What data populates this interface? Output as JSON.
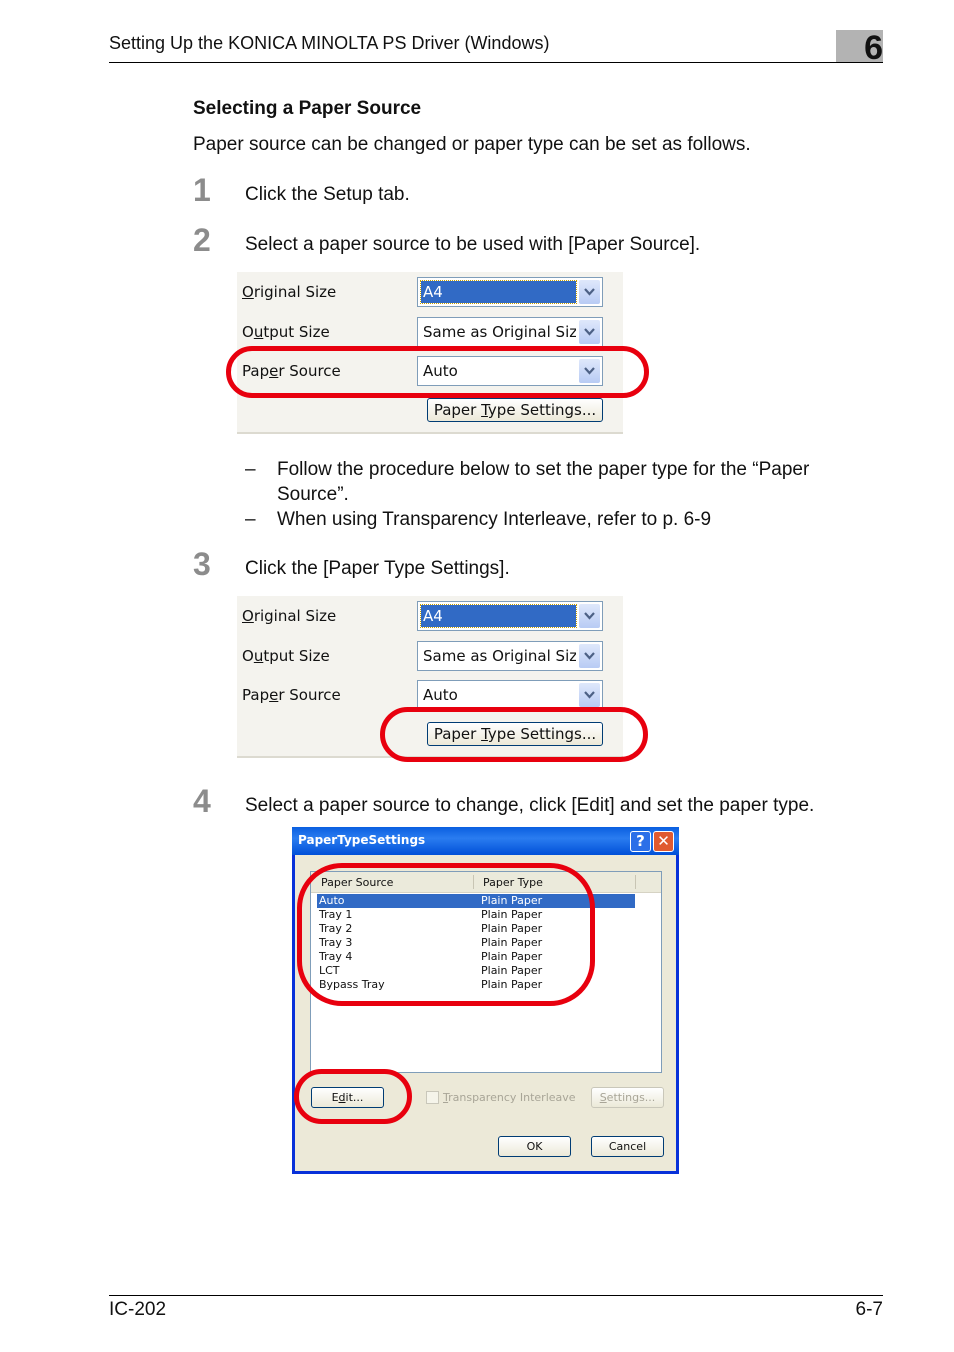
{
  "header": {
    "title": "Setting Up the KONICA MINOLTA PS Driver (Windows)",
    "chapter": "6"
  },
  "section": {
    "title": "Selecting a Paper Source",
    "intro": "Paper source can be changed or paper type can be set as follows."
  },
  "steps": [
    {
      "num": "1",
      "text": "Click the Setup tab."
    },
    {
      "num": "2",
      "text": "Select a paper source to be used with [Paper Source]."
    },
    {
      "num": "3",
      "text": "Click the [Paper Type Settings]."
    },
    {
      "num": "4",
      "text": "Select a paper source to change, click [Edit] and set the paper type."
    }
  ],
  "bullets": [
    {
      "dash": "–",
      "text": "Follow the procedure below to set the paper type for the “Paper Source”."
    },
    {
      "dash": "–",
      "text": "When using Transparency Interleave, refer to p. 6-9"
    }
  ],
  "driver_panel": {
    "original_size_label": "Original Size",
    "original_size_value": "A4",
    "output_size_label": "Output Size",
    "output_size_value": "Same as Original Size",
    "paper_source_label": "Paper Source",
    "paper_source_value": "Auto",
    "paper_type_button": "Paper Type Settings...",
    "dropdown_icon": "chevron-down-icon"
  },
  "dialog": {
    "title": "PaperTypeSettings",
    "help_glyph": "?",
    "close_glyph": "✕",
    "columns": [
      "Paper Source",
      "Paper Type"
    ],
    "rows": [
      {
        "source": "Auto",
        "type": "Plain Paper",
        "selected": true
      },
      {
        "source": "Tray 1",
        "type": "Plain Paper"
      },
      {
        "source": "Tray 2",
        "type": "Plain Paper"
      },
      {
        "source": "Tray 3",
        "type": "Plain Paper"
      },
      {
        "source": "Tray 4",
        "type": "Plain Paper"
      },
      {
        "source": "LCT",
        "type": "Plain Paper"
      },
      {
        "source": "Bypass Tray",
        "type": "Plain Paper"
      }
    ],
    "edit_button": "Edit...",
    "transparency_label": "Transparency Interleave",
    "settings_button": "Settings...",
    "ok_button": "OK",
    "cancel_button": "Cancel"
  },
  "footer": {
    "left": "IC-202",
    "right": "6-7"
  },
  "colors": {
    "highlight_ring": "#e8000e",
    "selection": "#316ac5",
    "step_number": "#8c8c8c",
    "chapter_box": "#b3b3b3"
  }
}
